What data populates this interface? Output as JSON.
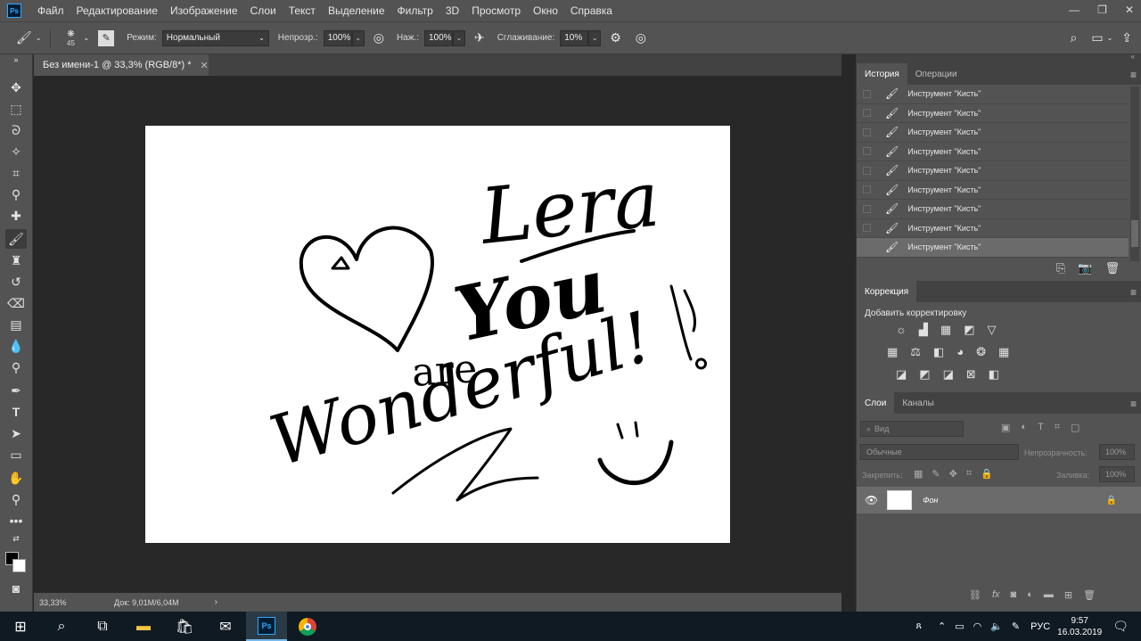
{
  "app": {
    "logo": "Ps"
  },
  "menubar": [
    "Файл",
    "Редактирование",
    "Изображение",
    "Слои",
    "Текст",
    "Выделение",
    "Фильтр",
    "3D",
    "Просмотр",
    "Окно",
    "Справка"
  ],
  "options": {
    "brush_size": "45",
    "mode_label": "Режим:",
    "mode_value": "Нормальный",
    "opacity_label": "Непрозр.:",
    "opacity_value": "100%",
    "pressure_label": "Наж.:",
    "pressure_value": "100%",
    "smoothing_label": "Сглаживание:",
    "smoothing_value": "10%"
  },
  "document": {
    "tab_title": "Без имени-1 @ 33,3% (RGB/8*) *",
    "zoom": "33,33%",
    "doc_info": "Док: 9,01M/6,04M"
  },
  "canvas_text": {
    "name": "Lera",
    "line1": "You",
    "line2": "are",
    "line3": "Wonderful!"
  },
  "history": {
    "tab_active": "История",
    "tab_other": "Операции",
    "items": [
      "Инструмент \"Кисть\"",
      "Инструмент \"Кисть\"",
      "Инструмент \"Кисть\"",
      "Инструмент \"Кисть\"",
      "Инструмент \"Кисть\"",
      "Инструмент \"Кисть\"",
      "Инструмент \"Кисть\"",
      "Инструмент \"Кисть\"",
      "Инструмент \"Кисть\""
    ]
  },
  "adjustments": {
    "tab": "Коррекция",
    "add_label": "Добавить корректировку"
  },
  "layers": {
    "tab_active": "Слои",
    "tab_other": "Каналы",
    "search_placeholder": "Вид",
    "blend_mode": "Обычные",
    "opacity_label": "Непрозрачность:",
    "opacity_value": "100%",
    "lock_label": "Закрепить:",
    "fill_label": "Заливка:",
    "fill_value": "100%",
    "layer_name": "Фон"
  },
  "taskbar": {
    "language": "РУС",
    "time": "9:57",
    "date": "16.03.2019"
  },
  "colors": {
    "accent": "#31a8ff",
    "panel": "#535353",
    "canvas_bg": "#282828"
  }
}
